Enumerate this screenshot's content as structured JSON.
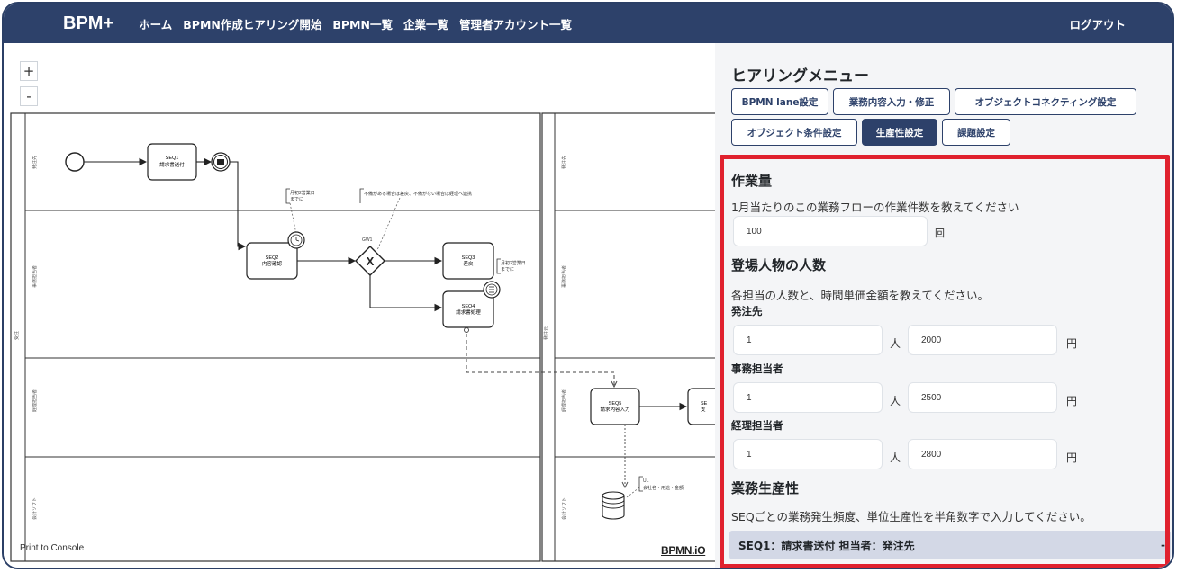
{
  "navbar": {
    "brand": "BPM+",
    "links": [
      "ホーム",
      "BPMN作成ヒアリング開始",
      "BPMN一覧",
      "企業一覧",
      "管理者アカウント一覧"
    ],
    "logout": "ログアウト"
  },
  "canvas": {
    "zoom_in": "+",
    "zoom_out": "-",
    "print_console": "Print to Console",
    "watermark": "BPMN.iO",
    "lanes": [
      "発注先",
      "事務担当者",
      "経理担当者",
      "会計ソフト"
    ],
    "pool_label": "受注",
    "pool2_label": "発注元",
    "tasks": {
      "seq1": [
        "SEQ1",
        "請求書送付"
      ],
      "seq2": [
        "SEQ2",
        "内容確認"
      ],
      "seq3": [
        "SEQ3",
        "差戻"
      ],
      "seq4": [
        "SEQ4",
        "請求書処理"
      ],
      "seq5": [
        "SEQ5",
        "請求内容入力"
      ],
      "seq6": [
        "SE",
        "支"
      ]
    },
    "annotations": {
      "a1": [
        "月初2営業日",
        "までに"
      ],
      "a2": "不備がある場合は差戻、不備がない場合は経理へ連携",
      "a3": [
        "月初2営業日",
        "までに"
      ],
      "a4": [
        "UL",
        "会社名・用途・金額"
      ]
    },
    "gateway_label": "GW1"
  },
  "panel": {
    "menu_title": "ヒアリングメニュー",
    "menu_buttons": [
      "BPMN lane設定",
      "業務内容入力・修正",
      "オブジェクトコネクティング設定",
      "オブジェクト条件設定",
      "生産性設定",
      "課題設定"
    ],
    "active_button": "生産性設定",
    "volume": {
      "heading": "作業量",
      "description": "1月当たりのこの業務フローの作業件数を教えてください",
      "value": "100",
      "unit": "回"
    },
    "people": {
      "heading": "登場人物の人数",
      "description": "各担当の人数と、時間単価金額を教えてください。",
      "rows": [
        {
          "label": "発注先",
          "count": "1",
          "count_unit": "人",
          "rate": "2000",
          "rate_unit": "円"
        },
        {
          "label": "事務担当者",
          "count": "1",
          "count_unit": "人",
          "rate": "2500",
          "rate_unit": "円"
        },
        {
          "label": "経理担当者",
          "count": "1",
          "count_unit": "人",
          "rate": "2800",
          "rate_unit": "円"
        }
      ]
    },
    "productivity": {
      "heading": "業務生産性",
      "description": "SEQごとの業務発生頻度、単位生産性を半角数字で入力してください。",
      "seq_title": "SEQ1：請求書送付 担当者：発注先",
      "collapse": "-"
    }
  }
}
